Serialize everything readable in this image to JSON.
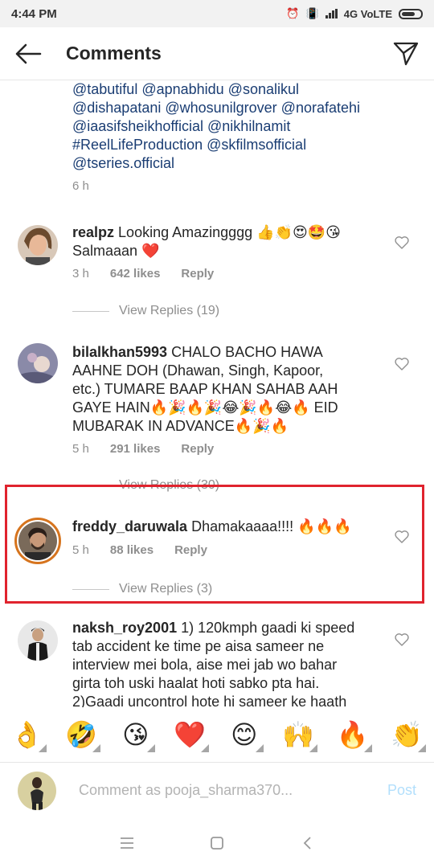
{
  "status_bar": {
    "time": "4:44 PM",
    "network": "4G VoLTE"
  },
  "header": {
    "title": "Comments"
  },
  "caption": {
    "lines": [
      "@tabutiful @apnabhidu @sonalikul",
      "@dishapatani @whosunilgrover @norafatehi",
      "@iaasifsheikhofficial @nikhilnamit",
      "#ReelLifeProduction @skfilmsofficial",
      "@tseries.official"
    ],
    "time": "6 h"
  },
  "comments": [
    {
      "username": "realpz",
      "text_lines": [
        "Looking Amazingggg 👍👏😍🤩😘",
        "Salmaaan ❤️"
      ],
      "time": "3 h",
      "likes": "642 likes",
      "reply": "Reply",
      "view_replies": "View Replies (19)"
    },
    {
      "username": "bilalkhan5993",
      "text_lines": [
        "CHALO BACHO HAWA",
        "AAHNE DOH (Dhawan, Singh, Kapoor,",
        "etc.) TUMARE BAAP KHAN SAHAB AAH",
        "GAYE HAIN🔥🎉🔥🎉😂🎉🔥😂🔥 EID",
        "MUBARAK IN ADVANCE🔥🎉🔥"
      ],
      "time": "5 h",
      "likes": "291 likes",
      "reply": "Reply",
      "view_replies": "View Replies (30)"
    },
    {
      "username": "freddy_daruwala",
      "text_lines": [
        "Dhamakaaaa!!!! 🔥🔥🔥"
      ],
      "time": "5 h",
      "likes": "88 likes",
      "reply": "Reply",
      "view_replies": "View Replies (3)"
    },
    {
      "username": "naksh_roy2001",
      "text_lines": [
        "1) 120kmph gaadi ki speed",
        "tab accident ke time pe aisa sameer ne",
        "interview mei bola, aise mei jab wo bahar",
        "girta toh uski haalat hoti sabko pta hai.",
        "2)Gaadi uncontrol hote hi sameer ke haath"
      ]
    }
  ],
  "emoji_bar": [
    "👌",
    "🤣",
    "😘",
    "❤️",
    "😊",
    "🙌",
    "🔥",
    "👏"
  ],
  "composer": {
    "placeholder": "Comment as pooja_sharma370...",
    "post_label": "Post"
  },
  "colors": {
    "highlight": "#e0232e",
    "caption_link": "#1a3d73",
    "post_disabled": "#b2dffc"
  }
}
